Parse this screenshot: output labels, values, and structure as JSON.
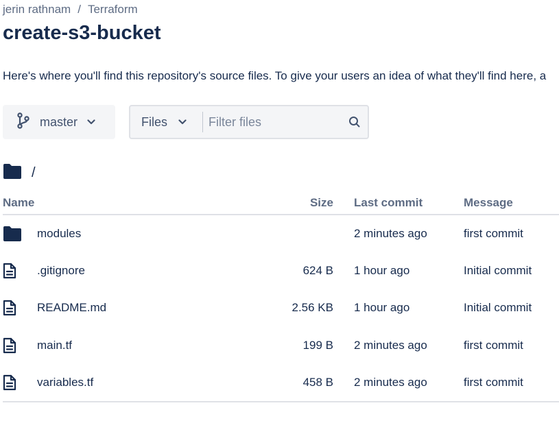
{
  "breadcrumb": {
    "owner": "jerin rathnam",
    "separator": "/",
    "project": "Terraform"
  },
  "repo": {
    "title": "create-s3-bucket",
    "description": "Here's where you'll find this repository's source files. To give your users an idea of what they'll find here, a"
  },
  "toolbar": {
    "branch": "master",
    "files_select": "Files",
    "filter_placeholder": "Filter files"
  },
  "path": "/",
  "table": {
    "headers": {
      "name": "Name",
      "size": "Size",
      "last_commit": "Last commit",
      "message": "Message"
    },
    "rows": [
      {
        "type": "folder",
        "name": "modules",
        "size": "",
        "last_commit": "2 minutes ago",
        "message": "first commit"
      },
      {
        "type": "file",
        "name": ".gitignore",
        "size": "624 B",
        "last_commit": "1 hour ago",
        "message": "Initial commit"
      },
      {
        "type": "file",
        "name": "README.md",
        "size": "2.56 KB",
        "last_commit": "1 hour ago",
        "message": "Initial commit"
      },
      {
        "type": "file",
        "name": "main.tf",
        "size": "199 B",
        "last_commit": "2 minutes ago",
        "message": "first commit"
      },
      {
        "type": "file",
        "name": "variables.tf",
        "size": "458 B",
        "last_commit": "2 minutes ago",
        "message": "first commit"
      }
    ]
  },
  "icons": {
    "branch": "branch-icon",
    "chevron": "chevron-down-icon",
    "search": "search-icon",
    "folder": "folder-icon",
    "file": "file-icon"
  },
  "colors": {
    "text": "#172b4d",
    "muted": "#5e6c84",
    "button_bg": "#f4f5f7",
    "border": "#dfe1e6"
  }
}
